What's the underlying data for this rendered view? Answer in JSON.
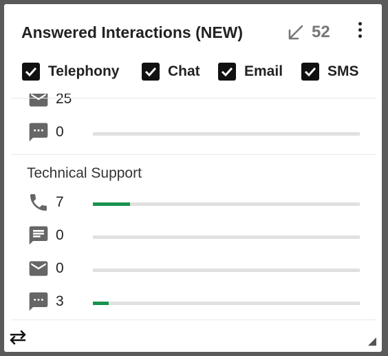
{
  "widget": {
    "title": "Answered Interactions (NEW)",
    "total": "52",
    "icons": {
      "trend": "arrow-down-left-icon",
      "menu": "more-vert-icon",
      "swap": "swap-arrows-icon",
      "resize": "resize-grip-icon"
    }
  },
  "filters": [
    {
      "label": "Telephony",
      "checked": true
    },
    {
      "label": "Chat",
      "checked": true
    },
    {
      "label": "Email",
      "checked": true
    },
    {
      "label": "SMS",
      "checked": true
    }
  ],
  "groups": [
    {
      "title": "",
      "rows": [
        {
          "channel": "email",
          "icon": "email-icon",
          "value": "25",
          "fraction": null
        },
        {
          "channel": "sms",
          "icon": "sms-icon",
          "value": "0",
          "fraction": 0
        }
      ]
    },
    {
      "title": "Technical Support",
      "rows": [
        {
          "channel": "telephony",
          "icon": "phone-icon",
          "value": "7",
          "fraction": 0.14
        },
        {
          "channel": "chat",
          "icon": "chat-icon",
          "value": "0",
          "fraction": 0
        },
        {
          "channel": "email",
          "icon": "email-icon",
          "value": "0",
          "fraction": 0
        },
        {
          "channel": "sms",
          "icon": "sms-icon",
          "value": "3",
          "fraction": 0.06
        }
      ]
    }
  ],
  "colors": {
    "bar_fill": "#16924f",
    "bar_track": "#e0e0e0",
    "icon": "#666666"
  }
}
